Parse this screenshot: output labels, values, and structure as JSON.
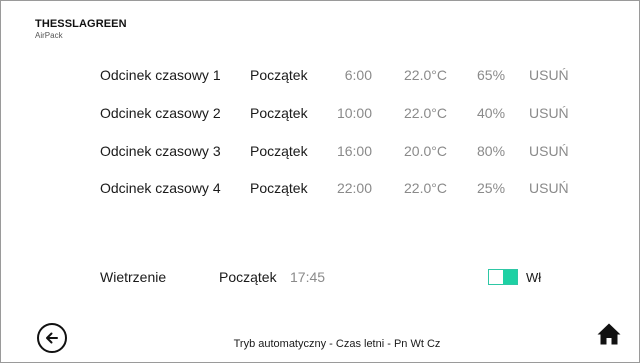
{
  "brand": {
    "name": "THESSLAGREEN",
    "product": "AirPack"
  },
  "schedule": [
    {
      "name": "Odcinek czasowy 1",
      "start_label": "Początek",
      "time": "6:00",
      "temp": "22.0°C",
      "humidity": "65%",
      "delete_label": "USUŃ"
    },
    {
      "name": "Odcinek czasowy 2",
      "start_label": "Początek",
      "time": "10:00",
      "temp": "22.0°C",
      "humidity": "40%",
      "delete_label": "USUŃ"
    },
    {
      "name": "Odcinek czasowy 3",
      "start_label": "Początek",
      "time": "16:00",
      "temp": "20.0°C",
      "humidity": "80%",
      "delete_label": "USUŃ"
    },
    {
      "name": "Odcinek czasowy 4",
      "start_label": "Początek",
      "time": "22:00",
      "temp": "22.0°C",
      "humidity": "25%",
      "delete_label": "USUŃ"
    }
  ],
  "ventilation": {
    "label": "Wietrzenie",
    "start_label": "Początek",
    "time": "17:45",
    "toggle_label": "Wł",
    "enabled": true
  },
  "footer": {
    "status": "Tryb automatyczny - Czas letni - Pn Wt Cz"
  },
  "colors": {
    "accent": "#1ed1a4",
    "muted_text": "#8a8a8a"
  },
  "icons": {
    "back": "arrow-left-circle-icon",
    "home": "home-icon"
  }
}
